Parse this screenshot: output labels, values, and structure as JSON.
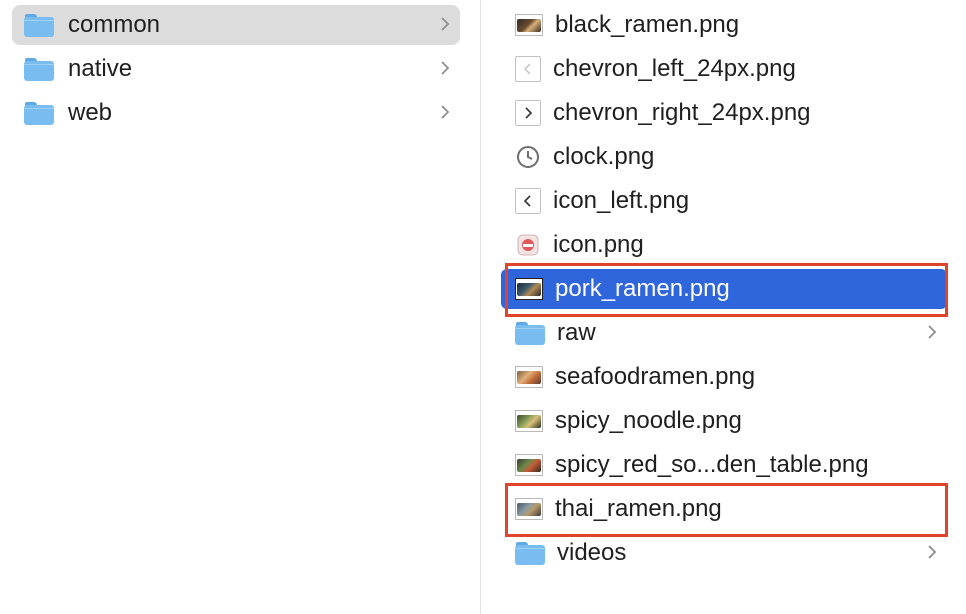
{
  "left_column": {
    "items": [
      {
        "label": "common",
        "kind": "folder",
        "selected": true
      },
      {
        "label": "native",
        "kind": "folder",
        "selected": false
      },
      {
        "label": "web",
        "kind": "folder",
        "selected": false
      }
    ]
  },
  "right_column": {
    "items": [
      {
        "label": "black_ramen.png",
        "icon": "image-thumbnail-icon"
      },
      {
        "label": "chevron_left_24px.png",
        "icon": "chevron-left-icon"
      },
      {
        "label": "chevron_right_24px.png",
        "icon": "chevron-right-icon"
      },
      {
        "label": "clock.png",
        "icon": "clock-icon"
      },
      {
        "label": "icon_left.png",
        "icon": "chevron-left-icon"
      },
      {
        "label": "icon.png",
        "icon": "app-icon"
      },
      {
        "label": "pork_ramen.png",
        "icon": "image-thumbnail-icon",
        "selected": true
      },
      {
        "label": "raw",
        "icon": "folder-icon"
      },
      {
        "label": "seafoodramen.png",
        "icon": "image-thumbnail-icon"
      },
      {
        "label": "spicy_noodle.png",
        "icon": "image-thumbnail-icon"
      },
      {
        "label": "spicy_red_so...den_table.png",
        "icon": "image-thumbnail-icon"
      },
      {
        "label": "thai_ramen.png",
        "icon": "image-thumbnail-icon"
      },
      {
        "label": "videos",
        "icon": "folder-icon"
      }
    ]
  },
  "colors": {
    "selection_blue": "#2f66dc",
    "selection_grey": "#dcdcdc",
    "highlight_red": "#e0442b",
    "folder_blue": "#79bdf0"
  }
}
